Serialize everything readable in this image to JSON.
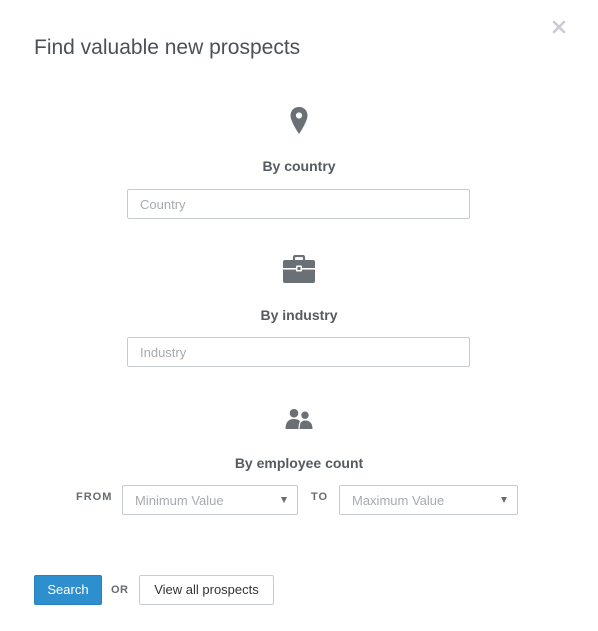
{
  "modal": {
    "title": "Find valuable new prospects",
    "close_icon": "close-icon"
  },
  "country": {
    "icon": "map-pin-icon",
    "label": "By country",
    "placeholder": "Country",
    "value": ""
  },
  "industry": {
    "icon": "briefcase-icon",
    "label": "By industry",
    "placeholder": "Industry",
    "value": ""
  },
  "employees": {
    "icon": "people-icon",
    "label": "By employee count",
    "from_label": "FROM",
    "to_label": "TO",
    "min_value": "Minimum Value",
    "max_value": "Maximum Value"
  },
  "footer": {
    "search_label": "Search",
    "or_label": "OR",
    "view_all_label": "View all prospects"
  },
  "colors": {
    "primary": "#2e8fce",
    "text": "#555b61",
    "icon": "#6a7075",
    "border": "#c7ccd1"
  }
}
